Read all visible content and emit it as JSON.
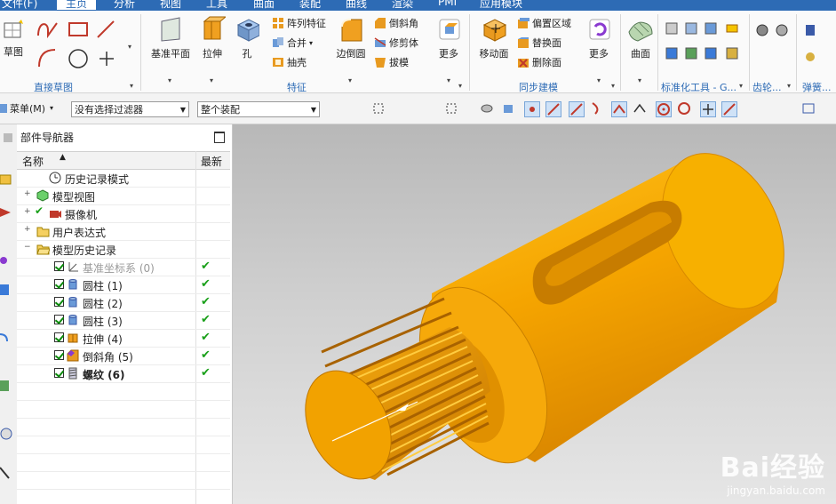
{
  "tabs": [
    {
      "label": "文件(F)"
    },
    {
      "label": "主页"
    },
    {
      "label": "分析"
    },
    {
      "label": "视图"
    },
    {
      "label": "工具"
    },
    {
      "label": "曲面"
    },
    {
      "label": "装配"
    },
    {
      "label": "曲线"
    },
    {
      "label": "渲染"
    },
    {
      "label": "PMI"
    },
    {
      "label": "应用模块"
    }
  ],
  "ribbon": {
    "sketch_label": "草图",
    "direct_sketch_group": "直接草图",
    "datum_plane": "基准平面",
    "extrude": "拉伸",
    "hole": "孔",
    "pattern_feature": "阵列特征",
    "unite": "合并",
    "shell": "抽壳",
    "edge_blend": "边倒圆",
    "chamfer": "倒斜角",
    "trim_body": "修剪体",
    "draft": "拔模",
    "more": "更多",
    "feature_group": "特征",
    "move_face": "移动面",
    "offset_region": "偏置区域",
    "replace_face": "替换面",
    "delete_face": "删除面",
    "more2": "更多",
    "sync_group": "同步建模",
    "surface": "曲面",
    "standard_parts_group": "标准化工具 - G...",
    "gear_group": "齿轮...",
    "spring_group": "弹簧..."
  },
  "toolbar": {
    "menu": "菜单(M)",
    "filter": "没有选择过滤器",
    "assembly": "整个装配"
  },
  "navigator": {
    "title": "部件导航器",
    "col_name": "名称",
    "col_latest": "最新",
    "rows": [
      {
        "label": "历史记录模式"
      },
      {
        "label": "模型视图"
      },
      {
        "label": "摄像机"
      },
      {
        "label": "用户表达式"
      },
      {
        "label": "模型历史记录"
      },
      {
        "label": "基准坐标系 (0)"
      },
      {
        "label": "圆柱 (1)"
      },
      {
        "label": "圆柱 (2)"
      },
      {
        "label": "圆柱 (3)"
      },
      {
        "label": "拉伸 (4)"
      },
      {
        "label": "倒斜角 (5)"
      },
      {
        "label": "螺纹 (6)"
      }
    ]
  },
  "watermark": {
    "brand": "Bai经验",
    "url": "jingyan.baidu.com"
  },
  "colors": {
    "accent": "#2d6bb5",
    "part": "#f5a400",
    "check": "#1aa01a"
  }
}
